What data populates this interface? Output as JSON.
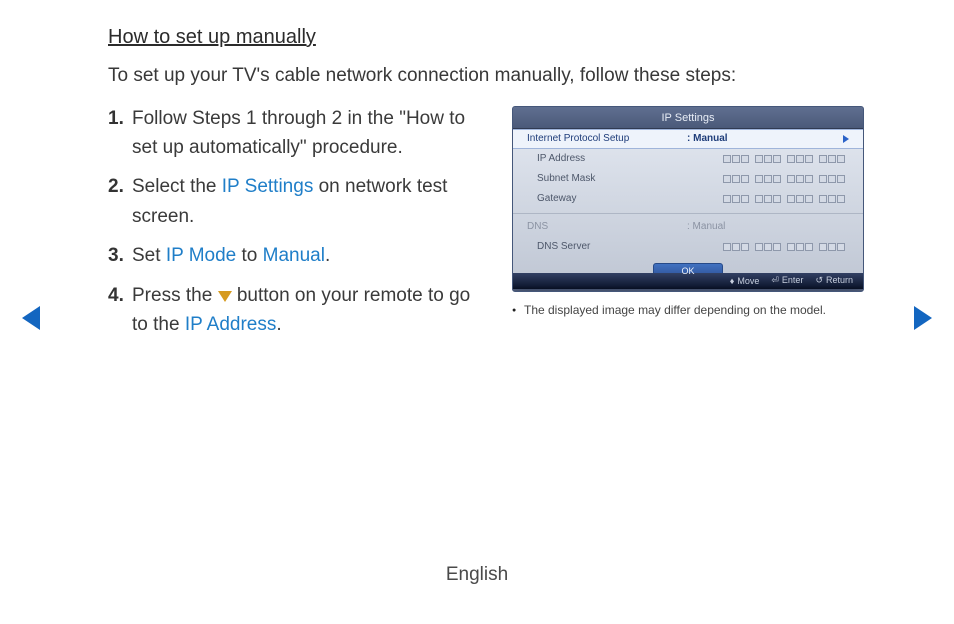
{
  "heading": "How to set up manually",
  "intro": "To set up your TV's cable network connection manually, follow these steps:",
  "steps": [
    {
      "pre": "Follow Steps 1 through 2 in the \"How to set up automatically\" procedure."
    },
    {
      "pre": "Select the ",
      "kw1": "IP Settings",
      "post": " on network test screen."
    },
    {
      "pre": "Set ",
      "kw1": "IP Mode",
      "mid": " to ",
      "kw2": "Manual",
      "post": "."
    },
    {
      "pre": "Press the ",
      "icon": "down",
      "mid": " button on your remote to go to the ",
      "kw1": "IP Address",
      "post": "."
    }
  ],
  "tv": {
    "title": "IP Settings",
    "rows": {
      "protocol_label": "Internet Protocol Setup",
      "protocol_value": ": Manual",
      "ip_label": "IP Address",
      "subnet_label": "Subnet Mask",
      "gateway_label": "Gateway",
      "dns_label": "DNS",
      "dns_value": ": Manual",
      "dns_server_label": "DNS Server"
    },
    "ok": "OK",
    "footer": {
      "move": "Move",
      "enter": "Enter",
      "return": "Return"
    }
  },
  "caption": "The displayed image may differ depending on the model.",
  "language": "English"
}
